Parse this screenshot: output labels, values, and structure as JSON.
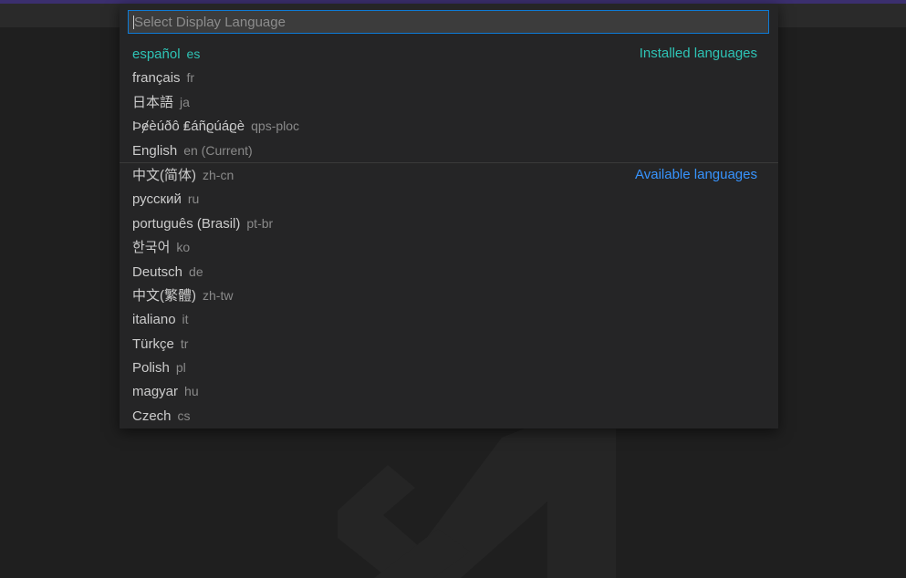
{
  "colors": {
    "accent_teal": "#2ec4b6",
    "accent_blue": "#3794ff",
    "focus_border": "#0e7bd6",
    "background": "#1f1f1f",
    "panel": "#252526"
  },
  "search": {
    "placeholder": "Select Display Language",
    "value": ""
  },
  "groups": {
    "installed_label": "Installed languages",
    "available_label": "Available languages"
  },
  "installed": [
    {
      "name": "español",
      "code": "es"
    },
    {
      "name": "français",
      "code": "fr"
    },
    {
      "name": "日本語",
      "code": "ja"
    },
    {
      "name": "Þɇèúðô ₤áñϱúáϱè",
      "code": "qps-ploc"
    },
    {
      "name": "English",
      "code": "en (Current)"
    }
  ],
  "available": [
    {
      "name": "中文(简体)",
      "code": "zh-cn"
    },
    {
      "name": "русский",
      "code": "ru"
    },
    {
      "name": "português (Brasil)",
      "code": "pt-br"
    },
    {
      "name": "한국어",
      "code": "ko"
    },
    {
      "name": "Deutsch",
      "code": "de"
    },
    {
      "name": "中文(繁體)",
      "code": "zh-tw"
    },
    {
      "name": "italiano",
      "code": "it"
    },
    {
      "name": "Türkçe",
      "code": "tr"
    },
    {
      "name": "Polish",
      "code": "pl"
    },
    {
      "name": "magyar",
      "code": "hu"
    },
    {
      "name": "Czech",
      "code": "cs"
    }
  ],
  "watermark_icon": "vscode-logo-icon"
}
